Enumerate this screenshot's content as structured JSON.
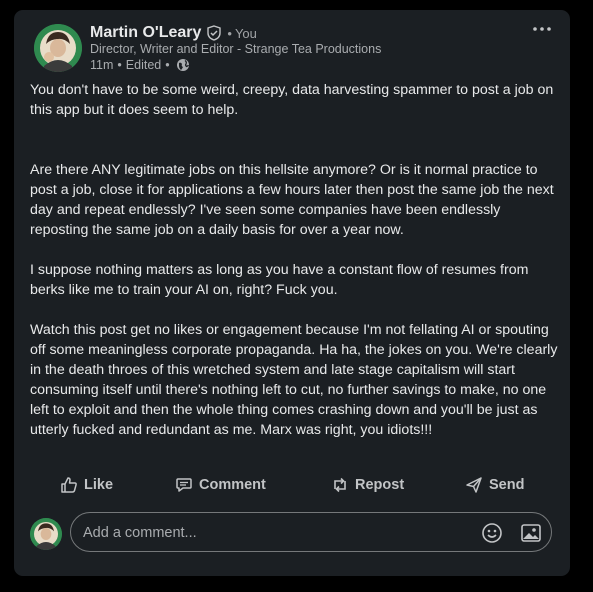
{
  "post": {
    "author": {
      "name": "Martin O'Leary",
      "relation_dot": "•",
      "relation": "You",
      "headline": "Director, Writer and Editor - Strange Tea Productions",
      "time": "11m",
      "edited": "Edited",
      "sep": "•",
      "visibility_icon": "globe-icon",
      "verified_icon": "verified-shield-icon"
    },
    "paragraphs": [
      "You don't have to be some weird, creepy, data harvesting spammer to post a job on this app but it does seem to help.",
      "Are there ANY legitimate jobs on this hellsite anymore? Or is it normal practice to post a job, close it for applications a few hours later then post the same job the next day and repeat endlessly? I've seen some companies have been endlessly reposting the same job on a daily basis for over a year now.",
      "I suppose nothing matters as long as you have a constant flow of resumes from berks like me to train your AI on, right? Fuck you.",
      "Watch this post get no likes or engagement because I'm not fellating AI or spouting off some meaningless corporate propaganda. Ha ha, the jokes on you. We're clearly in the death throes of this wretched system and late stage capitalism will start consuming itself until there's nothing left to cut, no further savings to make, no one left to exploit and then the whole thing comes crashing down and you'll be just as utterly fucked and redundant as me. Marx was right, you idiots!!!"
    ],
    "actions": {
      "like": "Like",
      "comment": "Comment",
      "repost": "Repost",
      "send": "Send"
    },
    "comment_box": {
      "placeholder": "Add a comment..."
    }
  },
  "colors": {
    "background": "#000000",
    "card": "#1b1f23",
    "text": "#e8e9ea",
    "muted": "#a9acaf"
  }
}
